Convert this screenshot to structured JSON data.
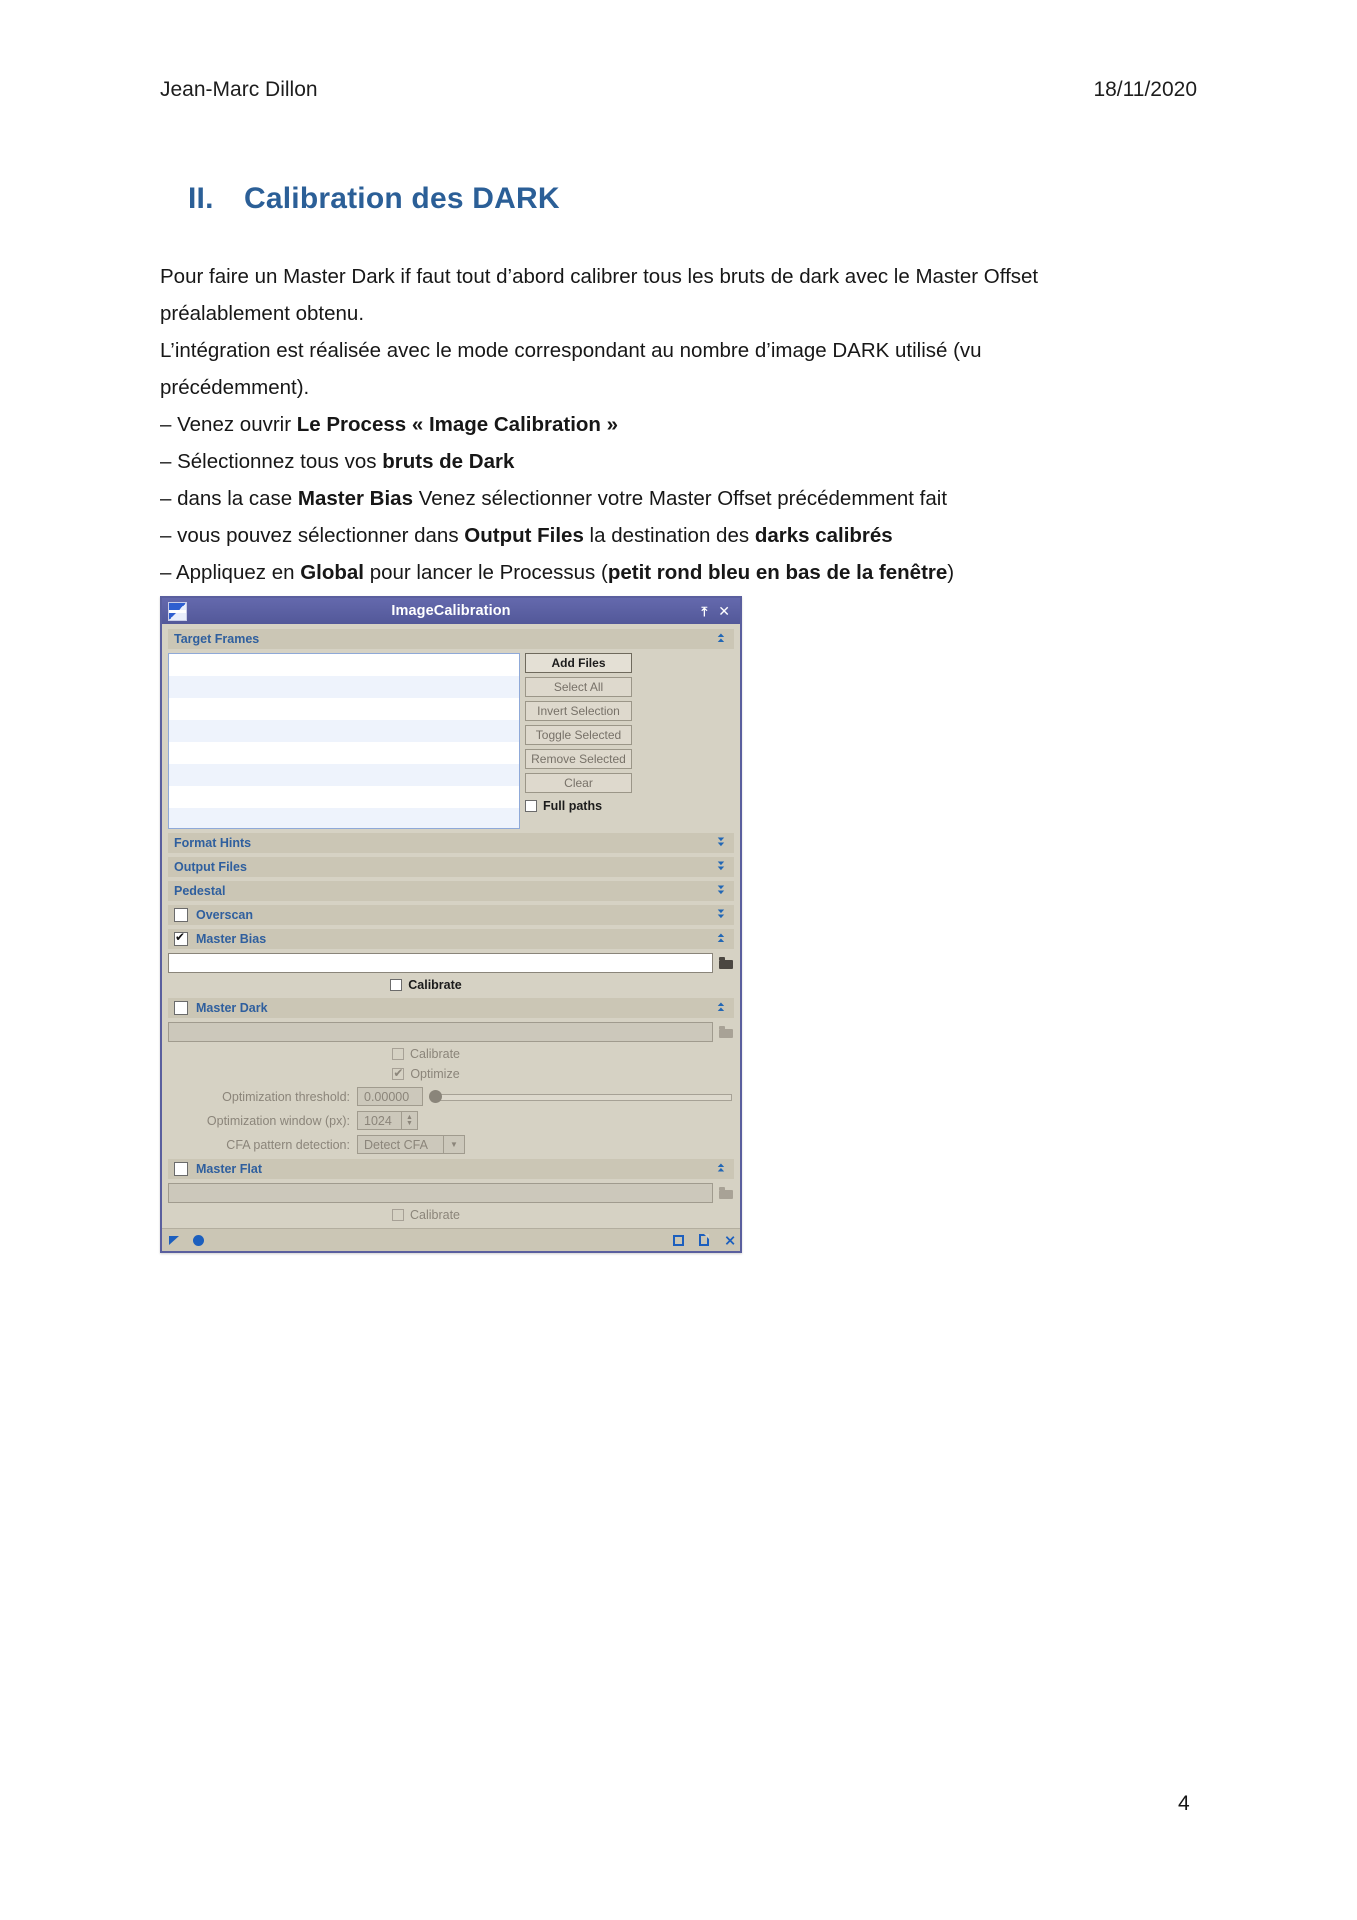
{
  "document": {
    "header": {
      "author": "Jean-Marc Dillon",
      "date": "18/11/2020"
    },
    "title": {
      "numeral": "II.",
      "text": "Calibration des DARK"
    },
    "paragraphs": {
      "p1_a": "Pour faire un Master Dark if faut tout d’abord calibrer tous les bruts de dark avec le Master Offset préalablement obtenu.",
      "p2_a": "L’intégration est réalisée avec le mode correspondant au nombre d’image DARK utilisé (vu précédemment)."
    },
    "bullets": [
      {
        "pre": "– Venez ouvrir ",
        "bold": "Le Process « Image Calibration »",
        "post": "",
        "bold2": "",
        "post2": ""
      },
      {
        "pre": "– Sélectionnez tous vos ",
        "bold": "bruts de  Dark",
        "post": "",
        "bold2": "",
        "post2": ""
      },
      {
        "pre": "– dans la case ",
        "bold": "Master Bias",
        "post": " Venez sélectionner votre Master Offset précédemment fait",
        "bold2": "",
        "post2": ""
      },
      {
        "pre": "– vous pouvez sélectionner dans ",
        "bold": "Output Files",
        "post": " la destination des ",
        "bold2": "darks calibrés",
        "post2": ""
      },
      {
        "pre": "– Appliquez en ",
        "bold": "Global",
        "post": " pour lancer le Processus (",
        "bold2": "petit rond bleu en bas de la fenêtre",
        "post2": ")"
      }
    ],
    "page_number": "4"
  },
  "dialog": {
    "title": "ImageCalibration",
    "titlebar_buttons": {
      "roll": "⤒",
      "close": "✕"
    },
    "sections": {
      "target_frames": {
        "label": "Target Frames",
        "state": "expanded",
        "buttons": [
          {
            "label": "Add Files",
            "enabled": true
          },
          {
            "label": "Select All",
            "enabled": false
          },
          {
            "label": "Invert Selection",
            "enabled": false
          },
          {
            "label": "Toggle Selected",
            "enabled": false
          },
          {
            "label": "Remove Selected",
            "enabled": false
          },
          {
            "label": "Clear",
            "enabled": false
          }
        ],
        "full_paths": {
          "label": "Full paths",
          "checked": false
        }
      },
      "format_hints": {
        "label": "Format Hints",
        "state": "collapsed"
      },
      "output_files": {
        "label": "Output Files",
        "state": "collapsed"
      },
      "pedestal": {
        "label": "Pedestal",
        "state": "collapsed"
      },
      "overscan": {
        "label": "Overscan",
        "state": "collapsed",
        "checked": false
      },
      "master_bias": {
        "label": "Master Bias",
        "state": "expanded",
        "checked": true,
        "path_value": "",
        "calibrate": {
          "label": "Calibrate",
          "checked": false,
          "enabled": true
        }
      },
      "master_dark": {
        "label": "Master Dark",
        "state": "expanded",
        "checked": false,
        "path_value": "",
        "calibrate": {
          "label": "Calibrate",
          "checked": false,
          "enabled": false
        },
        "optimize": {
          "label": "Optimize",
          "checked": true,
          "enabled": false
        },
        "optimization_threshold": {
          "label": "Optimization threshold:",
          "value": "0.00000",
          "slider_percent": 0
        },
        "optimization_window": {
          "label": "Optimization window (px):",
          "value": "1024"
        },
        "cfa_pattern_detection": {
          "label": "CFA pattern detection:",
          "value": "Detect CFA"
        }
      },
      "master_flat": {
        "label": "Master Flat",
        "state": "expanded",
        "checked": false,
        "path_value": "",
        "calibrate": {
          "label": "Calibrate",
          "checked": false,
          "enabled": false
        }
      }
    },
    "statusbar": {
      "apply_icon": "triangle-apply",
      "global_apply_icon": "circle-global-apply",
      "browse_icon": "square-instance",
      "new_instance_icon": "document-new-instance",
      "reset_icon": "reset-collapse"
    },
    "colors": {
      "titlebar": "#5a5fa5",
      "section_bar": "#cbc6b5",
      "section_label": "#2f5f9e",
      "accent_blue": "#1c5fbe",
      "dialog_bg": "#d6d2c4"
    }
  }
}
